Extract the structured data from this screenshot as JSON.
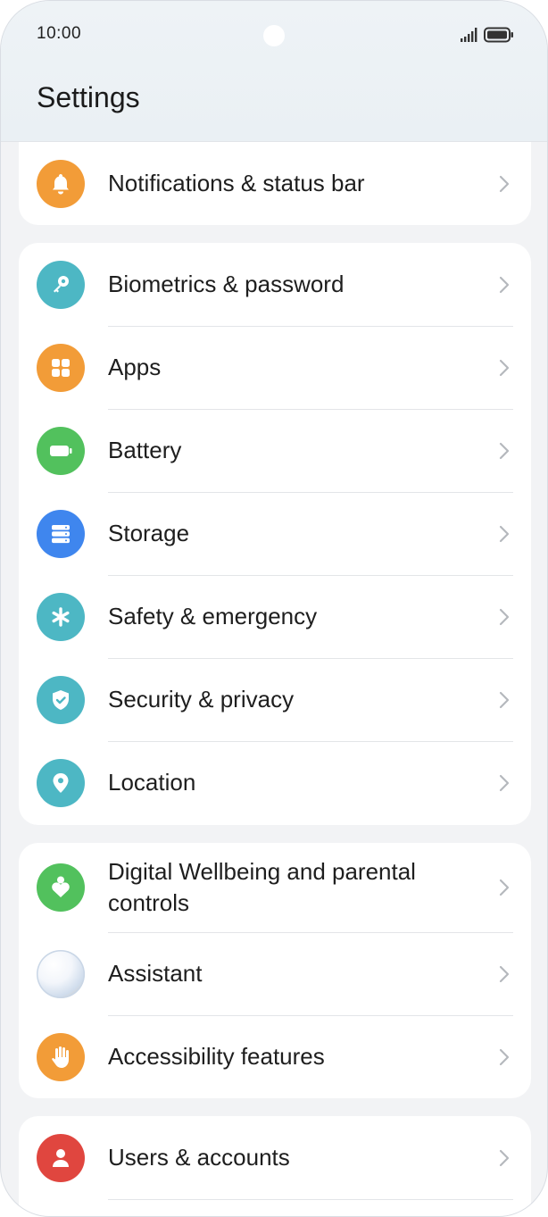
{
  "status_bar": {
    "time": "10:00"
  },
  "header": {
    "title": "Settings"
  },
  "colors": {
    "orange": "#f29c38",
    "teal": "#4db7c4",
    "green": "#52c15d",
    "blue": "#3f86ee",
    "red": "#e0463f"
  },
  "items": [
    {
      "label": "Notifications & status bar",
      "icon": "bell-icon"
    },
    {
      "label": "Biometrics & password",
      "icon": "key-icon"
    },
    {
      "label": "Apps",
      "icon": "apps-grid-icon"
    },
    {
      "label": "Battery",
      "icon": "battery-icon"
    },
    {
      "label": "Storage",
      "icon": "storage-icon"
    },
    {
      "label": "Safety & emergency",
      "icon": "asterisk-icon"
    },
    {
      "label": "Security & privacy",
      "icon": "shield-check-icon"
    },
    {
      "label": "Location",
      "icon": "location-pin-icon"
    },
    {
      "label": "Digital Wellbeing and parental controls",
      "icon": "wellbeing-heart-icon"
    },
    {
      "label": "Assistant",
      "icon": "assistant-orb-icon"
    },
    {
      "label": "Accessibility features",
      "icon": "hand-icon"
    },
    {
      "label": "Users & accounts",
      "icon": "user-icon"
    }
  ]
}
